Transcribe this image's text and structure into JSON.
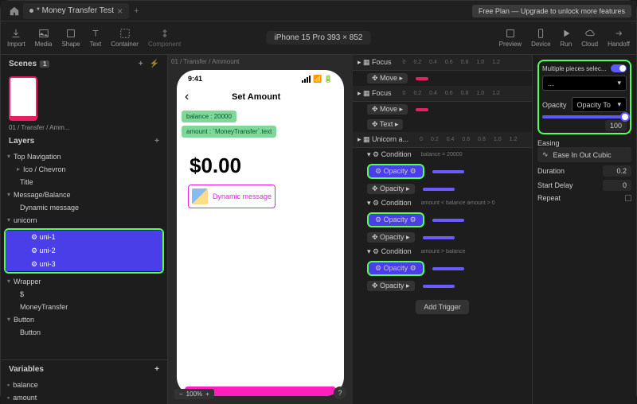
{
  "tab_title": "* Money Transfer Test",
  "upgrade": "Free Plan — Upgrade to unlock more features",
  "tools": {
    "import": "Import",
    "media": "Media",
    "shape": "Shape",
    "text": "Text",
    "container": "Container",
    "component": "Component",
    "preview": "Preview",
    "device": "Device",
    "run": "Run",
    "cloud": "Cloud",
    "handoff": "Handoff"
  },
  "device_label": "iPhone 15 Pro  393 × 852",
  "scenes": {
    "title": "Scenes",
    "count": "1",
    "thumb_label": "01 / Transfer / Amm..."
  },
  "layers": {
    "title": "Layers",
    "items": [
      {
        "t": "Top Navigation",
        "d": 0,
        "c": "▾"
      },
      {
        "t": "Ico / Chevron",
        "d": 1,
        "c": "▸"
      },
      {
        "t": "Title",
        "d": 1,
        "c": ""
      },
      {
        "t": "Message/Balance",
        "d": 0,
        "c": "▾"
      },
      {
        "t": "Dynamic message",
        "d": 1,
        "c": ""
      },
      {
        "t": "unicorn",
        "d": 0,
        "c": "▾"
      }
    ],
    "uni": [
      "uni-1",
      "uni-2",
      "uni-3"
    ],
    "items2": [
      {
        "t": "Wrapper",
        "d": 0,
        "c": "▾"
      },
      {
        "t": "$",
        "d": 1,
        "c": ""
      },
      {
        "t": "MoneyTransfer",
        "d": 1,
        "c": ""
      },
      {
        "t": "Button",
        "d": 0,
        "c": "▾"
      },
      {
        "t": "Button",
        "d": 1,
        "c": ""
      }
    ]
  },
  "variables": {
    "title": "Variables",
    "items": [
      "balance",
      "amount"
    ]
  },
  "canvas": {
    "crumb": "01 / Transfer / Ammount",
    "time": "9:41",
    "screen_title": "Set Amount",
    "tag1": "balance : 20000",
    "tag2": "amount : `MoneyTransfer`.text",
    "amount": "$0.00",
    "dyn": "Dynamic message",
    "zoom": "100%"
  },
  "timeline": {
    "groups": [
      {
        "name": "Focus",
        "rows": [
          {
            "l": "Move",
            "b": "p"
          }
        ]
      },
      {
        "name": "Focus",
        "rows": [
          {
            "l": "Move",
            "b": "p"
          },
          {
            "l": "Text",
            "b": ""
          }
        ]
      },
      {
        "name": "Unicorn a...",
        "rows": [
          {
            "cond": "Condition",
            "ct": "balance = 20000"
          },
          {
            "hl": "Opacity"
          },
          {
            "l": "Opacity",
            "b": "pu"
          },
          {
            "cond": "Condition",
            "ct": "amount < balance   amount > 0"
          },
          {
            "hl": "Opacity"
          },
          {
            "l": "Opacity",
            "b": "pu"
          },
          {
            "cond": "Condition",
            "ct": "amount > balance"
          },
          {
            "hl": "Opacity"
          },
          {
            "l": "Opacity",
            "b": "pu"
          }
        ]
      }
    ],
    "marks": [
      "0",
      "0.2",
      "0.4",
      "0.6",
      "0.8",
      "1.0",
      "1.2"
    ],
    "add": "Add Trigger"
  },
  "inspector": {
    "multi": "Multiple pieces selec...",
    "dots": "...",
    "opacity_lbl": "Opacity",
    "opacity_mode": "Opacity To",
    "opacity_val": "100",
    "easing_lbl": "Easing",
    "easing": "Ease In Out Cubic",
    "duration_lbl": "Duration",
    "duration": "0.2",
    "delay_lbl": "Start Delay",
    "delay": "0",
    "repeat_lbl": "Repeat"
  }
}
